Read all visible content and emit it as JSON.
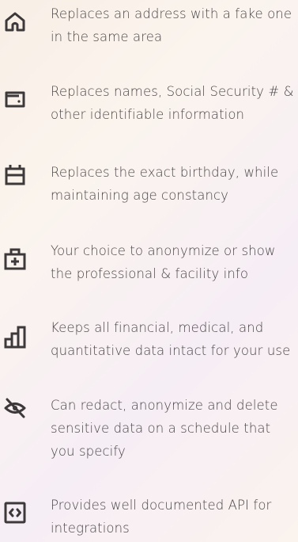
{
  "features": [
    {
      "icon": "home-icon",
      "text": "Replaces an address with a fake one in the same area"
    },
    {
      "icon": "id-card-icon",
      "text": "Replaces names, Social Security # & other identifiable information"
    },
    {
      "icon": "calendar-icon",
      "text": "Replaces the exact birthday, while maintaining age constancy"
    },
    {
      "icon": "medical-kit-icon",
      "text": "Your choice to anonymize or show the professional & facility info"
    },
    {
      "icon": "bar-chart-icon",
      "text": "Keeps all financial, medical, and quantitative data intact for your use"
    },
    {
      "icon": "eye-off-icon",
      "text": "Can redact, anonymize and delete sensitive data on a schedule that you specify"
    },
    {
      "icon": "code-icon",
      "text": "Provides well documented API for integrations"
    }
  ],
  "colors": {
    "icon": "#3d393a",
    "text": "#4a4647"
  }
}
